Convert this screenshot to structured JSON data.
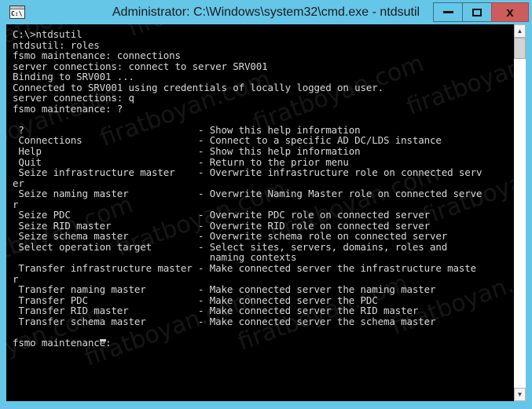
{
  "window": {
    "title": "Administrator: C:\\Windows\\system32\\cmd.exe - ntdsutil",
    "icon_name": "cmd-console-icon",
    "icon_text": "C:\\",
    "chrome_color": "#65c6e8",
    "close_button_color": "#cd5c5c",
    "console_background": "#000000",
    "console_foreground": "#d8d8d8"
  },
  "titlebar_buttons": {
    "minimize_label": "–",
    "maximize_label": "□",
    "close_label": "x"
  },
  "scrollbar": {
    "up_arrow": "▲",
    "down_arrow": "▼",
    "thumb_position_percent": 2,
    "track_color": "#ffffff",
    "thumb_color": "#d4d4d4"
  },
  "watermark": {
    "text": "firatboyan.com",
    "rotation_degrees": -20,
    "color": "rgba(255,255,255,0.085)"
  },
  "console": {
    "prompt_current": "fsmo maintenance:",
    "cursor": "_",
    "session_lines": [
      "C:\\>ntdsutil",
      "ntdsutil: roles",
      "fsmo maintenance: connections",
      "server connections: connect to server SRV001",
      "Binding to SRV001 ...",
      "Connected to SRV001 using credentials of locally logged on user.",
      "server connections: q",
      "fsmo maintenance: ?",
      "",
      " ?                              - Show this help information",
      " Connections                    - Connect to a specific AD DC/LDS instance",
      " Help                           - Show this help information",
      " Quit                           - Return to the prior menu",
      " Seize infrastructure master    - Overwrite infrastructure role on connected serv",
      "er",
      " Seize naming master            - Overwrite Naming Master role on connected serve",
      "r",
      " Seize PDC                      - Overwrite PDC role on connected server",
      " Seize RID master               - Overwrite RID role on connected server",
      " Seize schema master            - Overwrite schema role on connected server",
      " Select operation target        - Select sites, servers, domains, roles and",
      "                                  naming contexts",
      " Transfer infrastructure master - Make connected server the infrastructure maste",
      "r",
      " Transfer naming master         - Make connected server the naming master",
      " Transfer PDC                   - Make connected server the PDC",
      " Transfer RID master            - Make connected server the RID master",
      " Transfer schema master         - Make connected server the schema master",
      "",
      "fsmo maintenance: "
    ]
  }
}
